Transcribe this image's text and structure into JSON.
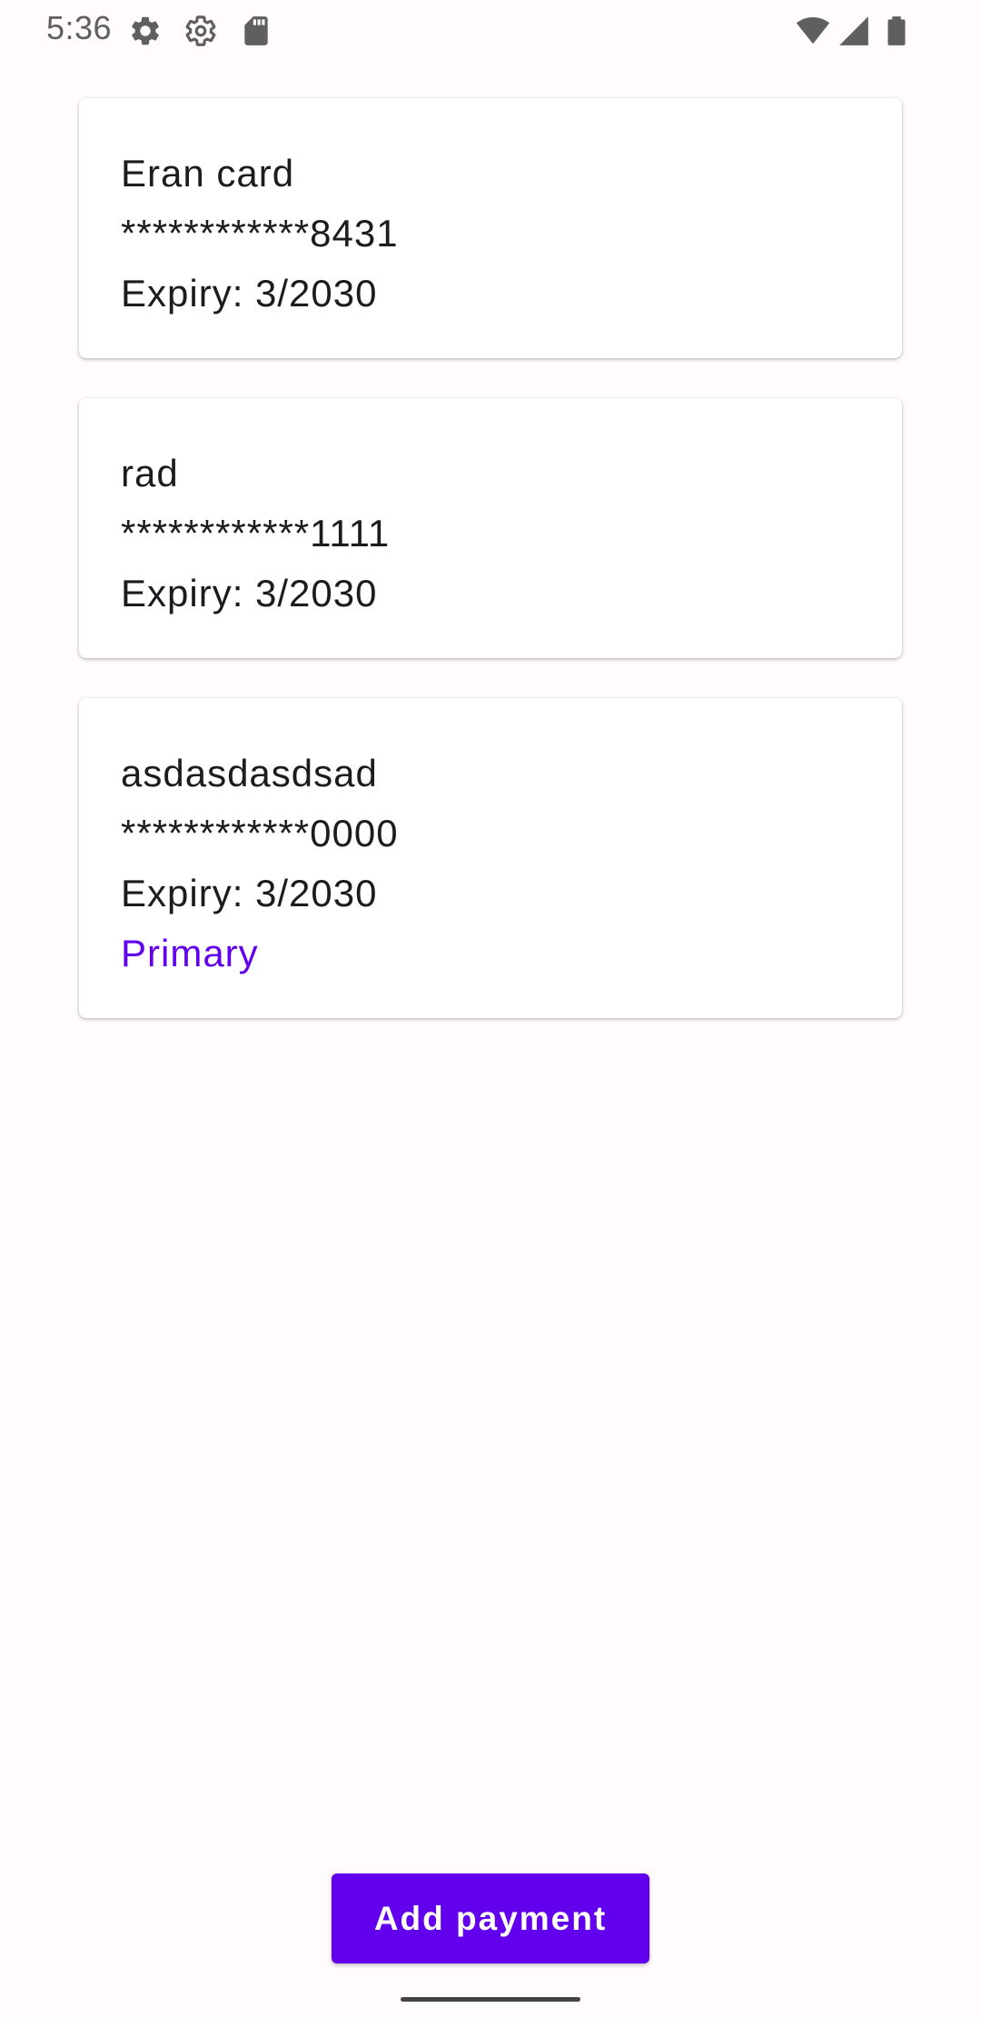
{
  "status_bar": {
    "time": "5:36",
    "left_icons": [
      "gear-icon",
      "settings-outline-icon",
      "sd-card-icon"
    ],
    "right_icons": [
      "wifi-icon",
      "cell-signal-icon",
      "battery-icon"
    ]
  },
  "cards": [
    {
      "name": "Eran card",
      "number": "************8431",
      "expiry": "Expiry: 3/2030",
      "badge": null
    },
    {
      "name": "rad",
      "number": "************1111",
      "expiry": "Expiry: 3/2030",
      "badge": null
    },
    {
      "name": "asdasdasdsad",
      "number": "************0000",
      "expiry": "Expiry: 3/2030",
      "badge": "Primary"
    }
  ],
  "add_button": {
    "label": "Add payment"
  },
  "colors": {
    "accent": "#6200ee",
    "background": "#fffbfe",
    "card": "#ffffff",
    "text": "#1c1b1f"
  }
}
